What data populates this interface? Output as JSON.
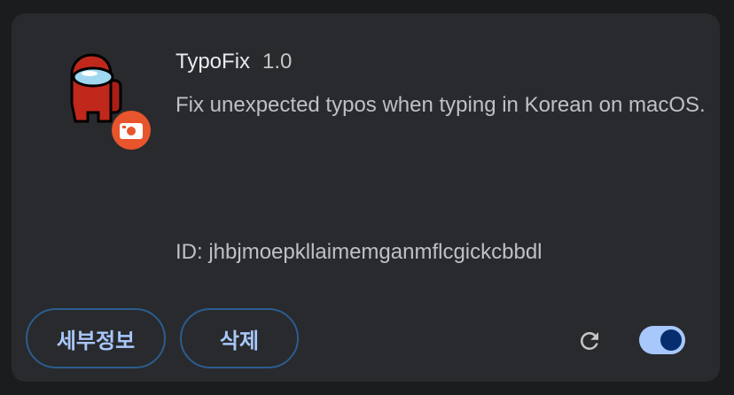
{
  "extension": {
    "name": "TypoFix",
    "version": "1.0",
    "description": "Fix unexpected typos when typing in Korean on macOS.",
    "id_text": "ID: jhbjmoepkllaimemganmflcgickcbbdl",
    "icon": "among-us-crewmate-icon",
    "badge_icon": "keyboard-badge-icon"
  },
  "actions": {
    "details_label": "세부정보",
    "remove_label": "삭제",
    "reload_icon": "reload-icon"
  },
  "toggle": {
    "enabled": true
  },
  "colors": {
    "card_bg": "#292a2d",
    "page_bg": "#1b1c1e",
    "accent": "#a8c7fa",
    "crewmate_red": "#c0281c",
    "badge_orange": "#e8542c"
  }
}
